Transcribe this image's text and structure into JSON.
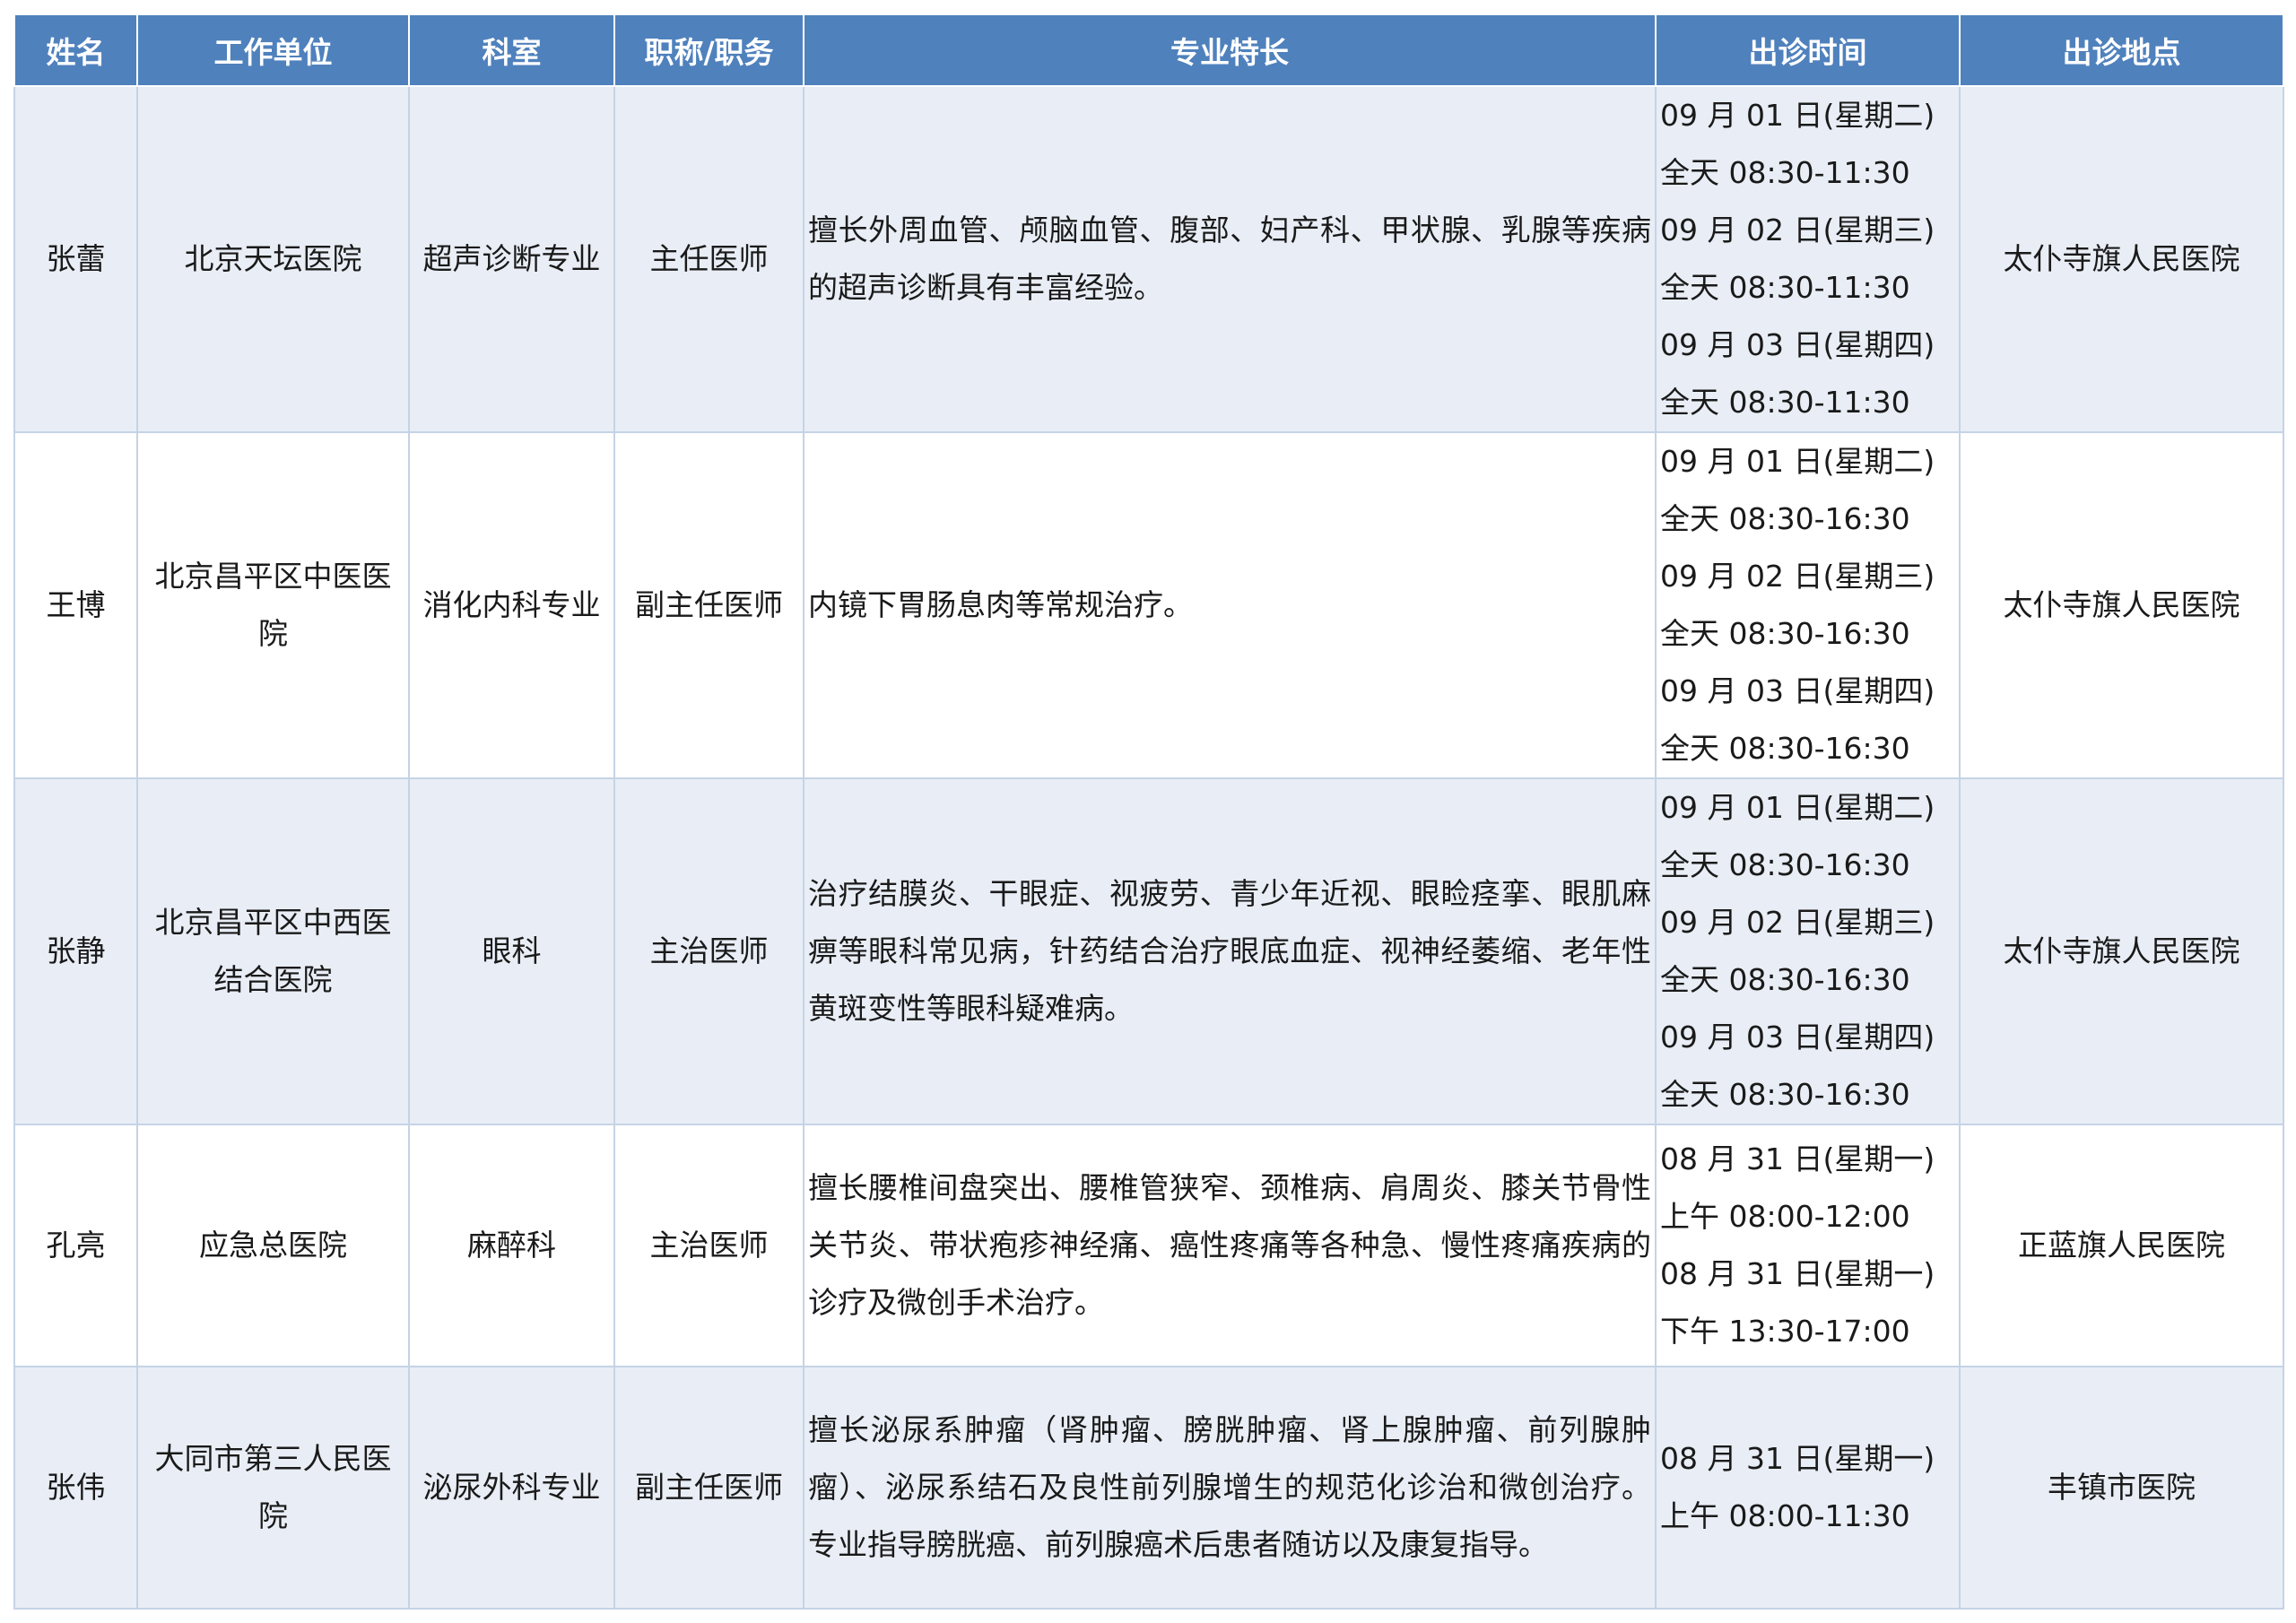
{
  "header": {
    "name": "姓名",
    "unit": "工作单位",
    "dept": "科室",
    "title": "职称/职务",
    "specialty": "专业特长",
    "time": "出诊时间",
    "place": "出诊地点"
  },
  "rows": [
    {
      "name": "张蕾",
      "unit": "北京天坛医院",
      "dept": "超声诊断专业",
      "title": "主任医师",
      "specialty": "擅长外周血管、颅脑血管、腹部、妇产科、甲状腺、乳腺等疾病的超声诊断具有丰富经验。",
      "schedule": [
        "09 月 01 日(星期二)",
        "全天 08:30-11:30",
        "09 月 02 日(星期三)",
        "全天 08:30-11:30",
        "09 月 03 日(星期四)",
        "全天 08:30-11:30"
      ],
      "place": "太仆寺旗人民医院"
    },
    {
      "name": "王博",
      "unit": "北京昌平区中医医院",
      "dept": "消化内科专业",
      "title": "副主任医师",
      "specialty": "内镜下胃肠息肉等常规治疗。",
      "schedule": [
        "09 月 01 日(星期二)",
        "全天 08:30-16:30",
        "09 月 02 日(星期三)",
        "全天 08:30-16:30",
        "09 月 03 日(星期四)",
        "全天 08:30-16:30"
      ],
      "place": "太仆寺旗人民医院"
    },
    {
      "name": "张静",
      "unit": "北京昌平区中西医结合医院",
      "dept": "眼科",
      "title": "主治医师",
      "specialty": "治疗结膜炎、干眼症、视疲劳、青少年近视、眼睑痉挛、眼肌麻痹等眼科常见病，针药结合治疗眼底血症、视神经萎缩、老年性黄斑变性等眼科疑难病。",
      "schedule": [
        "09 月 01 日(星期二)",
        "全天 08:30-16:30",
        "09 月 02 日(星期三)",
        "全天 08:30-16:30",
        "09 月 03 日(星期四)",
        "全天 08:30-16:30"
      ],
      "place": "太仆寺旗人民医院"
    },
    {
      "name": "孔亮",
      "unit": "应急总医院",
      "dept": "麻醉科",
      "title": "主治医师",
      "specialty": "擅长腰椎间盘突出、腰椎管狭窄、颈椎病、肩周炎、膝关节骨性关节炎、带状疱疹神经痛、癌性疼痛等各种急、慢性疼痛疾病的诊疗及微创手术治疗。",
      "schedule": [
        "08 月 31 日(星期一)",
        "上午 08:00-12:00",
        "08 月 31 日(星期一)",
        "下午 13:30-17:00"
      ],
      "place": "正蓝旗人民医院"
    },
    {
      "name": "张伟",
      "unit": "大同市第三人民医院",
      "dept": "泌尿外科专业",
      "title": "副主任医师",
      "specialty": "擅长泌尿系肿瘤（肾肿瘤、膀胱肿瘤、肾上腺肿瘤、前列腺肿瘤）、泌尿系结石及良性前列腺增生的规范化诊治和微创治疗。专业指导膀胱癌、前列腺癌术后患者随访以及康复指导。",
      "schedule": [
        "08 月 31 日(星期一)",
        "上午 08:00-11:30"
      ],
      "place": "丰镇市医院"
    }
  ]
}
